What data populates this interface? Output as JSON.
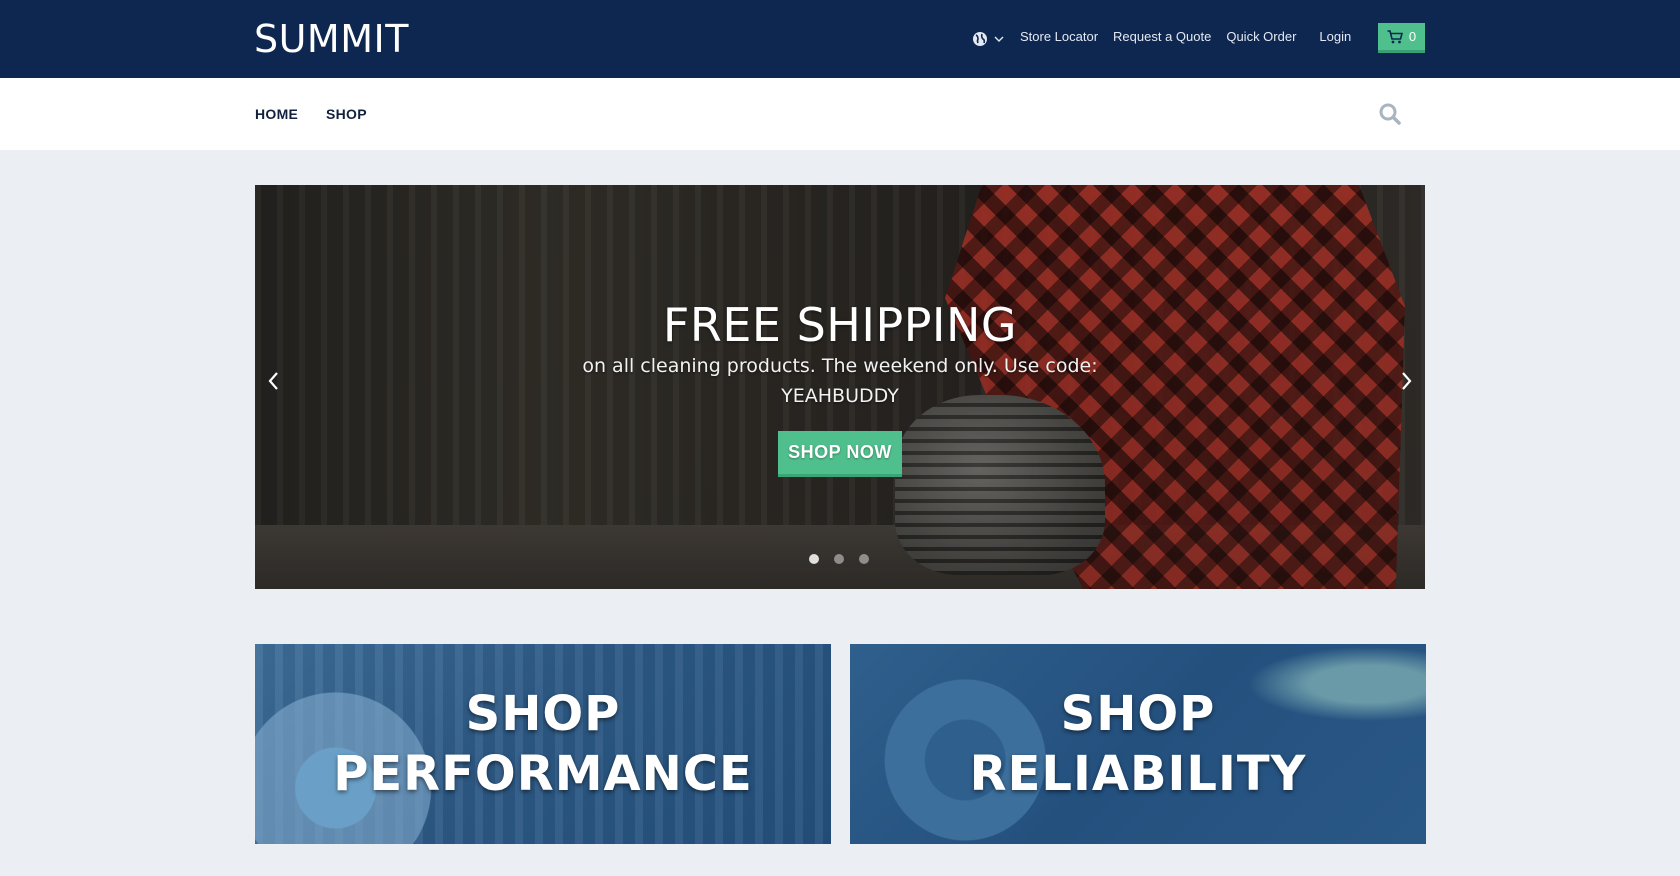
{
  "header": {
    "logo": "SUMMIT",
    "links": [
      "Store Locator",
      "Request a Quote",
      "Quick Order"
    ],
    "login": "Login",
    "cart_count": "0"
  },
  "nav": {
    "items": [
      "HOME",
      "SHOP"
    ]
  },
  "hero": {
    "title": "FREE SHIPPING",
    "subtitle": "on all cleaning products. The weekend only. Use code: YEAHBUDDY",
    "button": "SHOP NOW",
    "slides": 3,
    "active_slide": 1
  },
  "promos": [
    {
      "line1": "SHOP",
      "line2": "PERFORMANCE"
    },
    {
      "line1": "SHOP",
      "line2": "RELIABILITY"
    }
  ],
  "colors": {
    "header_bg": "#0e2750",
    "accent_green": "#4fc08d",
    "page_bg": "#ebeff3",
    "nav_text": "#12223e"
  }
}
